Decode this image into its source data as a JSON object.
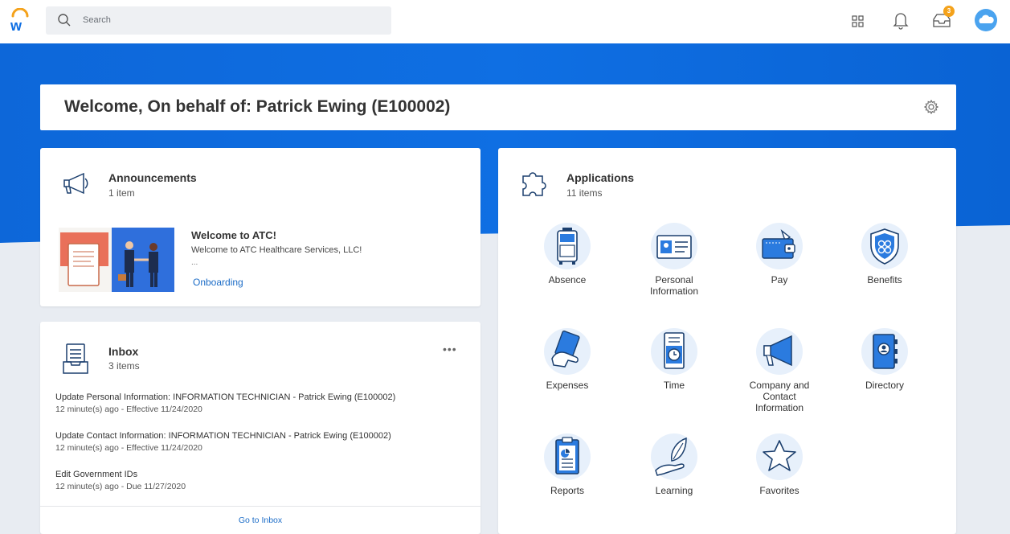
{
  "search": {
    "placeholder": "Search"
  },
  "header": {
    "notification_count": "3"
  },
  "welcome": {
    "title": "Welcome, On behalf of: Patrick Ewing (E100002)"
  },
  "announcements": {
    "title": "Announcements",
    "count": "1 item",
    "item": {
      "title": "Welcome to ATC!",
      "text": "Welcome to ATC Healthcare Services, LLC!",
      "ellipsis": "...",
      "link": "Onboarding"
    }
  },
  "inbox": {
    "title": "Inbox",
    "count": "3 items",
    "more": "•••",
    "items": [
      {
        "title": "Update Personal Information: INFORMATION TECHNICIAN - Patrick Ewing (E100002)",
        "sub": "12 minute(s) ago - Effective 11/24/2020"
      },
      {
        "title": "Update Contact Information: INFORMATION TECHNICIAN - Patrick Ewing (E100002)",
        "sub": "12 minute(s) ago - Effective 11/24/2020"
      },
      {
        "title": "Edit Government IDs",
        "sub": "12 minute(s) ago - Due 11/27/2020"
      }
    ],
    "go_link": "Go to Inbox"
  },
  "applications": {
    "title": "Applications",
    "count": "11 items",
    "apps": [
      {
        "label": "Absence",
        "icon": "absence-icon"
      },
      {
        "label": "Personal\nInformation",
        "icon": "personal-information-icon"
      },
      {
        "label": "Pay",
        "icon": "pay-icon"
      },
      {
        "label": "Benefits",
        "icon": "benefits-icon"
      },
      {
        "label": "Expenses",
        "icon": "expenses-icon"
      },
      {
        "label": "Time",
        "icon": "time-icon"
      },
      {
        "label": "Company and\nContact\nInformation",
        "icon": "company-contact-icon"
      },
      {
        "label": "Directory",
        "icon": "directory-icon"
      },
      {
        "label": "Reports",
        "icon": "reports-icon"
      },
      {
        "label": "Learning",
        "icon": "learning-icon"
      },
      {
        "label": "Favorites",
        "icon": "favorites-icon"
      }
    ]
  },
  "colors": {
    "brand_blue": "#0f6fe3",
    "link": "#1b6cc7",
    "badge": "#f4a21b"
  }
}
